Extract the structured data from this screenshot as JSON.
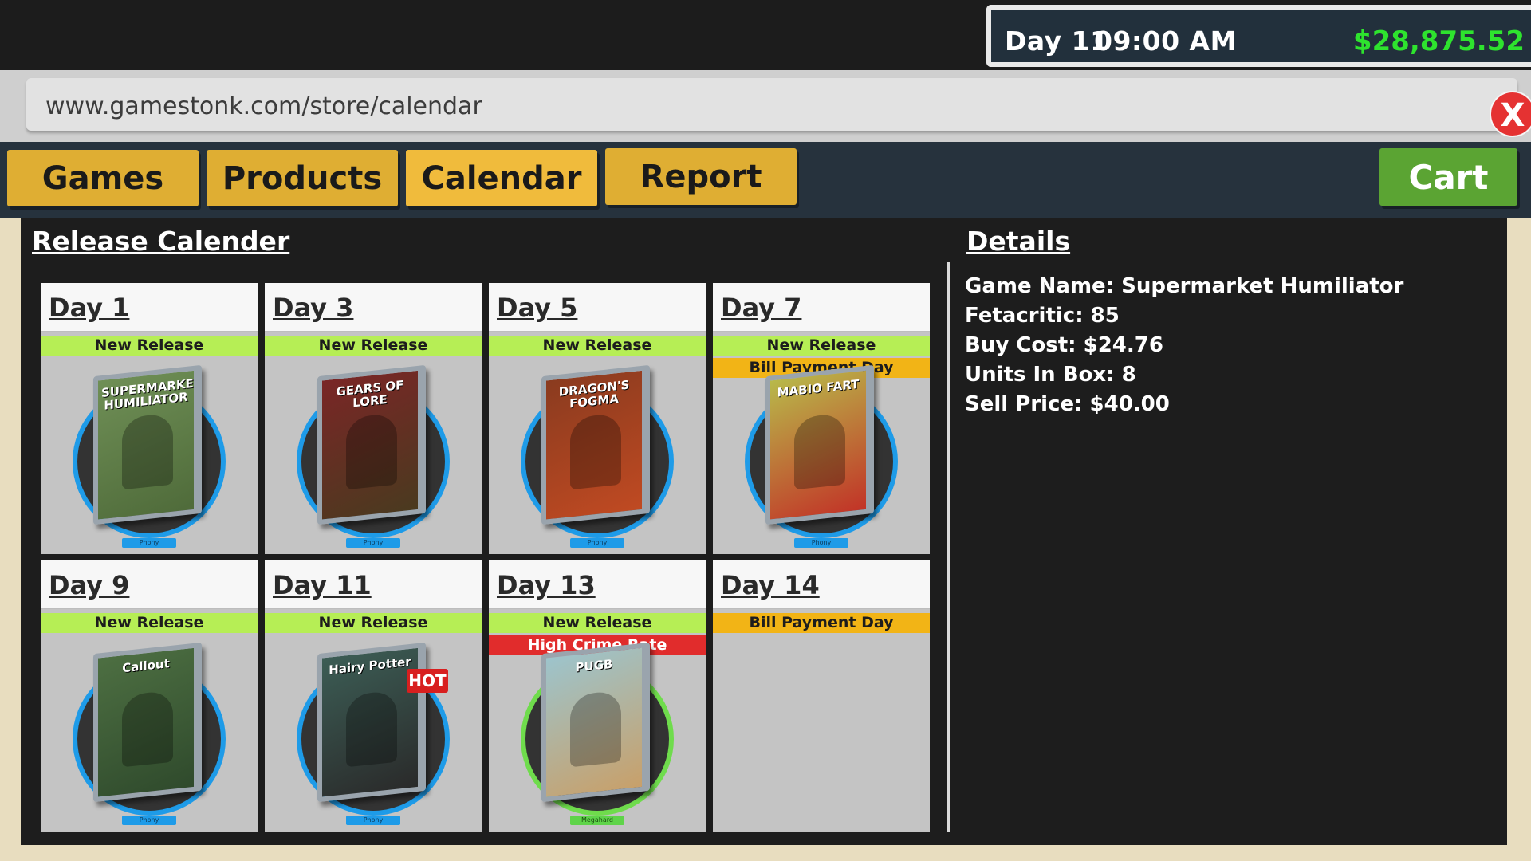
{
  "status": {
    "day": "Day 11",
    "time": "09:00 AM",
    "money": "$28,875.52"
  },
  "browser": {
    "url": "www.gamestonk.com/store/calendar",
    "close_label": "X"
  },
  "nav": {
    "tabs": [
      {
        "label": "Games"
      },
      {
        "label": "Products"
      },
      {
        "label": "Calendar",
        "active": true
      },
      {
        "label": "Report"
      }
    ],
    "cart_label": "Cart"
  },
  "calendar": {
    "title": "Release Calender",
    "days": [
      {
        "day": "Day 1",
        "tags": [
          "New Release"
        ],
        "cover_title": "SUPERMARKET HUMILIATOR",
        "platform": "Phony"
      },
      {
        "day": "Day 3",
        "tags": [
          "New Release"
        ],
        "cover_title": "GEARS OF LORE",
        "platform": "Phony"
      },
      {
        "day": "Day 5",
        "tags": [
          "New Release"
        ],
        "cover_title": "DRAGON'S FOGMA",
        "platform": "Phony"
      },
      {
        "day": "Day 7",
        "tags": [
          "New Release",
          "Bill Payment Day"
        ],
        "cover_title": "MABIO FART",
        "platform": "Phony"
      },
      {
        "day": "Day 9",
        "tags": [
          "New Release"
        ],
        "cover_title": "Callout",
        "platform": "Phony"
      },
      {
        "day": "Day 11",
        "tags": [
          "New Release"
        ],
        "cover_title": "Hairy Potter",
        "platform": "Phony",
        "badge": "HOT"
      },
      {
        "day": "Day 13",
        "tags": [
          "New Release",
          "High Crime Rate"
        ],
        "cover_title": "PUGB",
        "platform": "Megahard"
      },
      {
        "day": "Day 14",
        "tags": [
          "Bill Payment Day"
        ]
      }
    ]
  },
  "details": {
    "title": "Details",
    "lines": [
      "Game Name: Supermarket Humiliator",
      "Fetacritic: 85",
      "Buy Cost: $24.76",
      "Units In Box: 8",
      "Sell Price: $40.00"
    ]
  },
  "colors": {
    "new_release": "#b6ee55",
    "bill_payment": "#f2b416",
    "high_crime": "#e12c2c",
    "money": "#2ee32e",
    "nav_button": "#dfae33",
    "cart_button": "#5ba433"
  }
}
